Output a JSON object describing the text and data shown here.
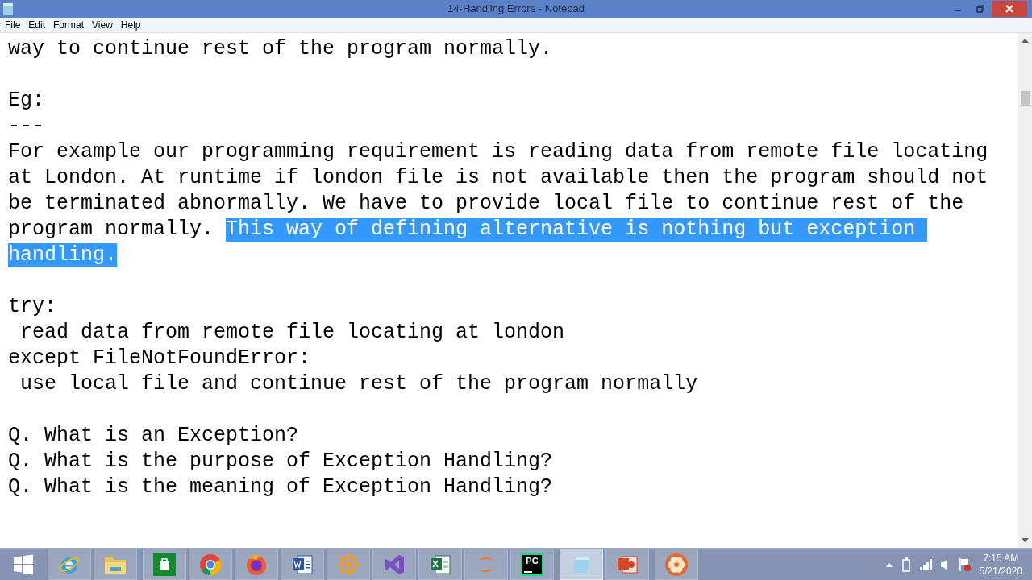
{
  "window": {
    "title": "14-Handling Errors - Notepad"
  },
  "menu": [
    {
      "label": "File"
    },
    {
      "label": "Edit"
    },
    {
      "label": "Format"
    },
    {
      "label": "View"
    },
    {
      "label": "Help"
    }
  ],
  "lines": [
    {
      "kind": "text",
      "segments": [
        {
          "text": "way to continue rest of the program normally.",
          "selected": false
        }
      ]
    },
    {
      "kind": "blank"
    },
    {
      "kind": "text",
      "segments": [
        {
          "text": "Eg:",
          "selected": false
        }
      ]
    },
    {
      "kind": "text",
      "segments": [
        {
          "text": "---",
          "selected": false
        }
      ]
    },
    {
      "kind": "text",
      "segments": [
        {
          "text": "For example our programming requirement is reading data from remote file locating",
          "selected": false
        }
      ]
    },
    {
      "kind": "text",
      "segments": [
        {
          "text": "at London. At runtime if london file is not available then the program should not",
          "selected": false
        }
      ]
    },
    {
      "kind": "text",
      "segments": [
        {
          "text": "be terminated abnormally. We have to provide local file to continue rest of the",
          "selected": false
        }
      ]
    },
    {
      "kind": "text",
      "segments": [
        {
          "text": "program normally. ",
          "selected": false
        },
        {
          "text": "This way of defining alternative is nothing but exception ",
          "selected": true
        }
      ]
    },
    {
      "kind": "text",
      "segments": [
        {
          "text": "handling.",
          "selected": true
        }
      ]
    },
    {
      "kind": "blank"
    },
    {
      "kind": "text",
      "segments": [
        {
          "text": "try:",
          "selected": false
        }
      ]
    },
    {
      "kind": "text",
      "segments": [
        {
          "text": " read data from remote file locating at london",
          "selected": false
        }
      ]
    },
    {
      "kind": "text",
      "segments": [
        {
          "text": "except FileNotFoundError:",
          "selected": false
        }
      ]
    },
    {
      "kind": "text",
      "segments": [
        {
          "text": " use local file and continue rest of the program normally",
          "selected": false
        }
      ]
    },
    {
      "kind": "blank"
    },
    {
      "kind": "text",
      "segments": [
        {
          "text": "Q. What is an Exception?",
          "selected": false
        }
      ]
    },
    {
      "kind": "text",
      "segments": [
        {
          "text": "Q. What is the purpose of Exception Handling?",
          "selected": false
        }
      ]
    },
    {
      "kind": "text",
      "segments": [
        {
          "text": "Q. What is the meaning of Exception Handling?",
          "selected": false
        }
      ]
    }
  ],
  "taskbar": [
    {
      "kind": "start",
      "selected": false
    },
    {
      "kind": "browser-e",
      "selected": false
    },
    {
      "kind": "folder",
      "selected": false
    },
    {
      "kind": "store",
      "selected": false
    },
    {
      "kind": "chrome",
      "selected": false
    },
    {
      "kind": "firefox",
      "selected": false
    },
    {
      "kind": "word",
      "selected": false
    },
    {
      "kind": "flower",
      "selected": false
    },
    {
      "kind": "vs",
      "selected": false
    },
    {
      "kind": "excel",
      "selected": false
    },
    {
      "kind": "jupyter",
      "selected": false
    },
    {
      "kind": "pycharm",
      "selected": false,
      "text": "PC"
    },
    {
      "kind": "notepad",
      "selected": true
    },
    {
      "kind": "powerpoint",
      "selected": false
    },
    {
      "kind": "camera",
      "selected": false
    }
  ],
  "tray": {
    "time": "7:15 AM",
    "date": "5/21/2020"
  }
}
